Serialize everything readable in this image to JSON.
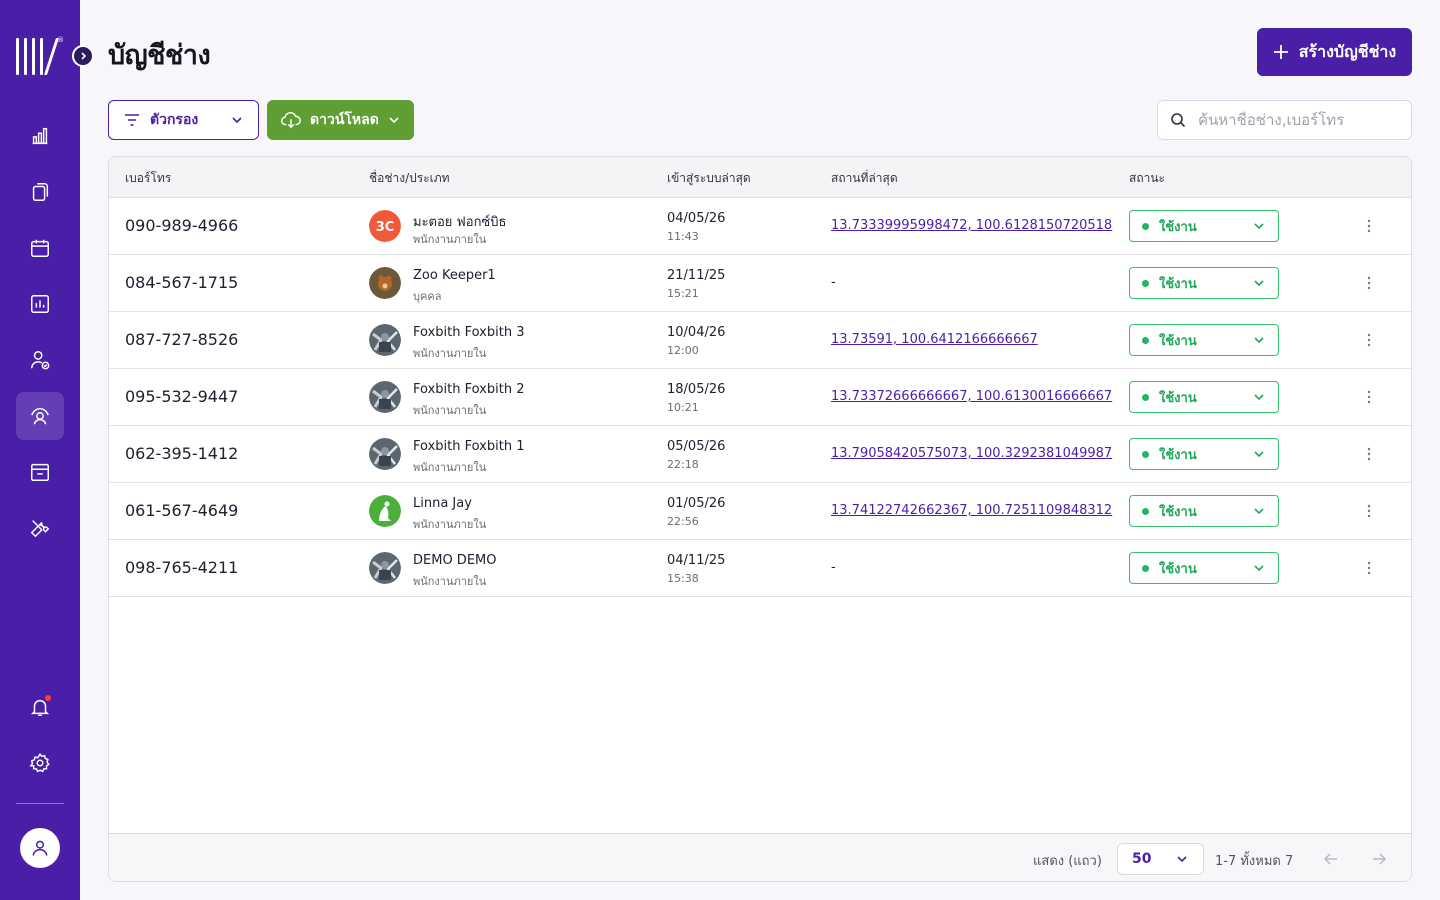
{
  "page": {
    "title": "บัญชีช่าง",
    "create_button": "สร้างบัญชีช่าง"
  },
  "toolbar": {
    "filter_label": "ตัวกรอง",
    "download_label": "ดาวน์โหลด",
    "search_placeholder": "ค้นหาชื่อช่าง,เบอร์โทร"
  },
  "sidebar": {
    "items": [
      {
        "icon": "bar-chart-icon"
      },
      {
        "icon": "documents-icon"
      },
      {
        "icon": "calendar-icon"
      },
      {
        "icon": "report-icon"
      },
      {
        "icon": "user-check-icon"
      },
      {
        "icon": "technician-icon",
        "active": true
      },
      {
        "icon": "archive-icon"
      },
      {
        "icon": "tools-icon"
      }
    ],
    "bottom": [
      {
        "icon": "bell-icon"
      },
      {
        "icon": "gear-icon"
      }
    ]
  },
  "table": {
    "columns": [
      "เบอร์โทร",
      "ชื่อช่าง/ประเภท",
      "เข้าสู่ระบบล่าสุด",
      "สถานที่ล่าสุด",
      "สถานะ"
    ],
    "rows": [
      {
        "phone": "090-989-4966",
        "name": "มะตอย ฟอกซ์บิธ",
        "type": "พนักงานภายใน",
        "date": "04/05/26",
        "time": "11:43",
        "location": "13.73339995998472, 100.6128150720518",
        "status": "ใช้งาน",
        "avatar": "logo"
      },
      {
        "phone": "084-567-1715",
        "name": "Zoo Keeper1",
        "type": "บุคคล",
        "date": "21/11/25",
        "time": "15:21",
        "location": "-",
        "status": "ใช้งาน",
        "avatar": "bear"
      },
      {
        "phone": "087-727-8526",
        "name": "Foxbith Foxbith 3",
        "type": "พนักงานภายใน",
        "date": "10/04/26",
        "time": "12:00",
        "location": "13.73591, 100.6412166666667",
        "status": "ใช้งาน",
        "avatar": "photo"
      },
      {
        "phone": "095-532-9447",
        "name": "Foxbith Foxbith 2",
        "type": "พนักงานภายใน",
        "date": "18/05/26",
        "time": "10:21",
        "location": "13.73372666666667, 100.6130016666667",
        "status": "ใช้งาน",
        "avatar": "photo"
      },
      {
        "phone": "062-395-1412",
        "name": "Foxbith Foxbith 1",
        "type": "พนักงานภายใน",
        "date": "05/05/26",
        "time": "22:18",
        "location": "13.79058420575073, 100.3292381049987",
        "status": "ใช้งาน",
        "avatar": "photo"
      },
      {
        "phone": "061-567-4649",
        "name": "Linna Jay",
        "type": "พนักงานภายใน",
        "date": "01/05/26",
        "time": "22:56",
        "location": "13.74122742662367, 100.7251109848312",
        "status": "ใช้งาน",
        "avatar": "green"
      },
      {
        "phone": "098-765-4211",
        "name": "DEMO DEMO",
        "type": "พนักงานภายใน",
        "date": "04/11/25",
        "time": "15:38",
        "location": "-",
        "status": "ใช้งาน",
        "avatar": "photo"
      }
    ]
  },
  "pagination": {
    "rows_label": "แสดง (แถว)",
    "rows_value": "50",
    "range": "1-7 ทั้งหมด 7"
  },
  "colors": {
    "brand": "#4a1fa8",
    "download": "#5e9e32",
    "status_active": "#22a85a"
  }
}
